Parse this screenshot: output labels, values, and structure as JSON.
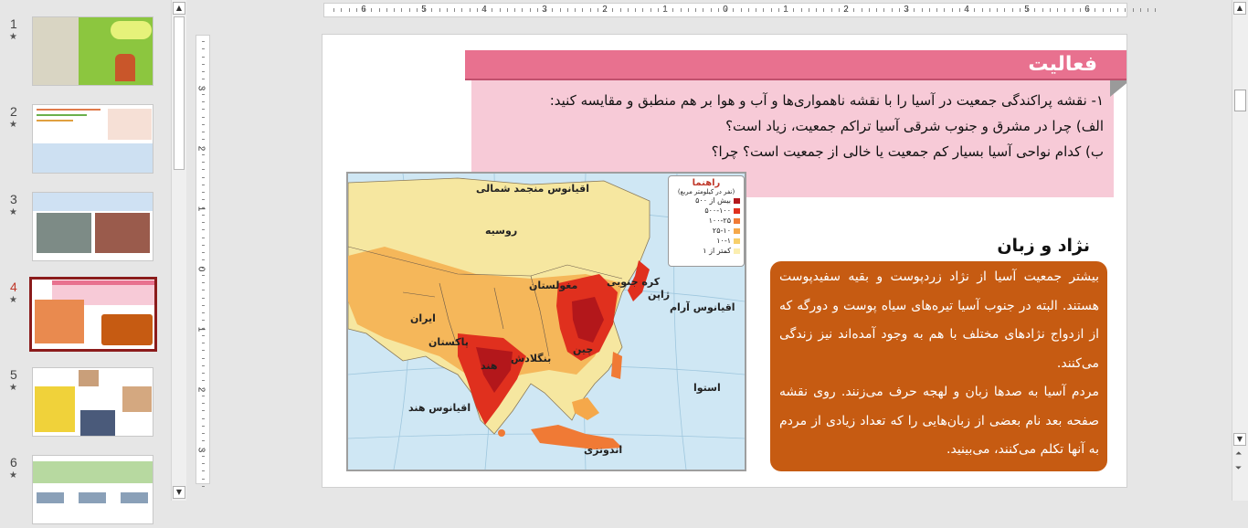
{
  "thumbnails": [
    {
      "number": "1",
      "star": "★"
    },
    {
      "number": "2",
      "star": "★"
    },
    {
      "number": "3",
      "star": "★"
    },
    {
      "number": "4",
      "star": "★"
    },
    {
      "number": "5",
      "star": "★"
    },
    {
      "number": "6",
      "star": "★"
    }
  ],
  "ruler": {
    "horizontal": [
      "6",
      "5",
      "4",
      "3",
      "2",
      "1",
      "0",
      "1",
      "2",
      "3",
      "4",
      "5",
      "6"
    ],
    "vertical": [
      "3",
      "2",
      "1",
      "0",
      "1",
      "2",
      "3"
    ]
  },
  "slide": {
    "activity_title": "فعالیت",
    "activity_lines": [
      "۱- نقشه پراکندگی جمعیت در آسیا را با نقشه ناهمواری‌ها و آب و هوا بر هم منطبق و مقایسه کنید:",
      "الف) چرا در مشرق و جنوب شرقی آسیا تراکم جمعیت، زیاد است؟",
      "ب) کدام نواحی آسیا بسیار کم جمعیت یا خالی از جمعیت است؟ چرا؟"
    ],
    "race_heading": "نژاد و زبان",
    "race_paragraph_1": "بیشتر جمعیت آسیا از نژاد زردپوست و بقیه سفیدپوست هستند. البته در جنوب آسیا تیره‌های سیاه پوست و دورگه که از ازدواج نژادهای مختلف با هم به وجود آمده‌اند نیز زندگی می‌کنند.",
    "race_paragraph_2": "مردم آسیا به صدها زبان و لهجه حرف می‌زنند. روی نقشه صفحه بعد نام بعضی از زبان‌هایی را که تعداد زیادی از مردم به آنها تکلم می‌کنند، می‌بینید."
  },
  "map": {
    "labels": {
      "arctic_ocean": "اقیانوس منجمد شمالی",
      "russia": "روسیه",
      "mongolia": "مغولستان",
      "japan": "ژاپن",
      "korea": "کره جنوبی",
      "pacific": "اقیانوس آرام",
      "iran": "ایران",
      "pakistan": "پاکستان",
      "china": "چین",
      "india": "هند",
      "bangladesh": "بنگلادش",
      "indian_ocean": "اقیانوس هند",
      "indonesia": "اندونزی",
      "equator": "استوا"
    },
    "legend": {
      "title": "راهنما",
      "subtitle": "(نفر در کیلومتر مربع)",
      "items": [
        {
          "label": "بیش از ۵۰۰",
          "color": "#b3171b"
        },
        {
          "label": "۵۰۰-۱۰۰",
          "color": "#e0301e"
        },
        {
          "label": "۱۰۰-۲۵",
          "color": "#f07a35"
        },
        {
          "label": "۲۵-۱۰",
          "color": "#f5a84a"
        },
        {
          "label": "۱۰-۱",
          "color": "#f7cf6a"
        },
        {
          "label": "کمتر از ۱",
          "color": "#fbeeb0"
        }
      ]
    }
  },
  "colors": {
    "activity_banner": "#e8718f",
    "activity_box": "#f7cad7",
    "race_box": "#c65b12",
    "selected_thumb_border": "#8b1b1b"
  }
}
